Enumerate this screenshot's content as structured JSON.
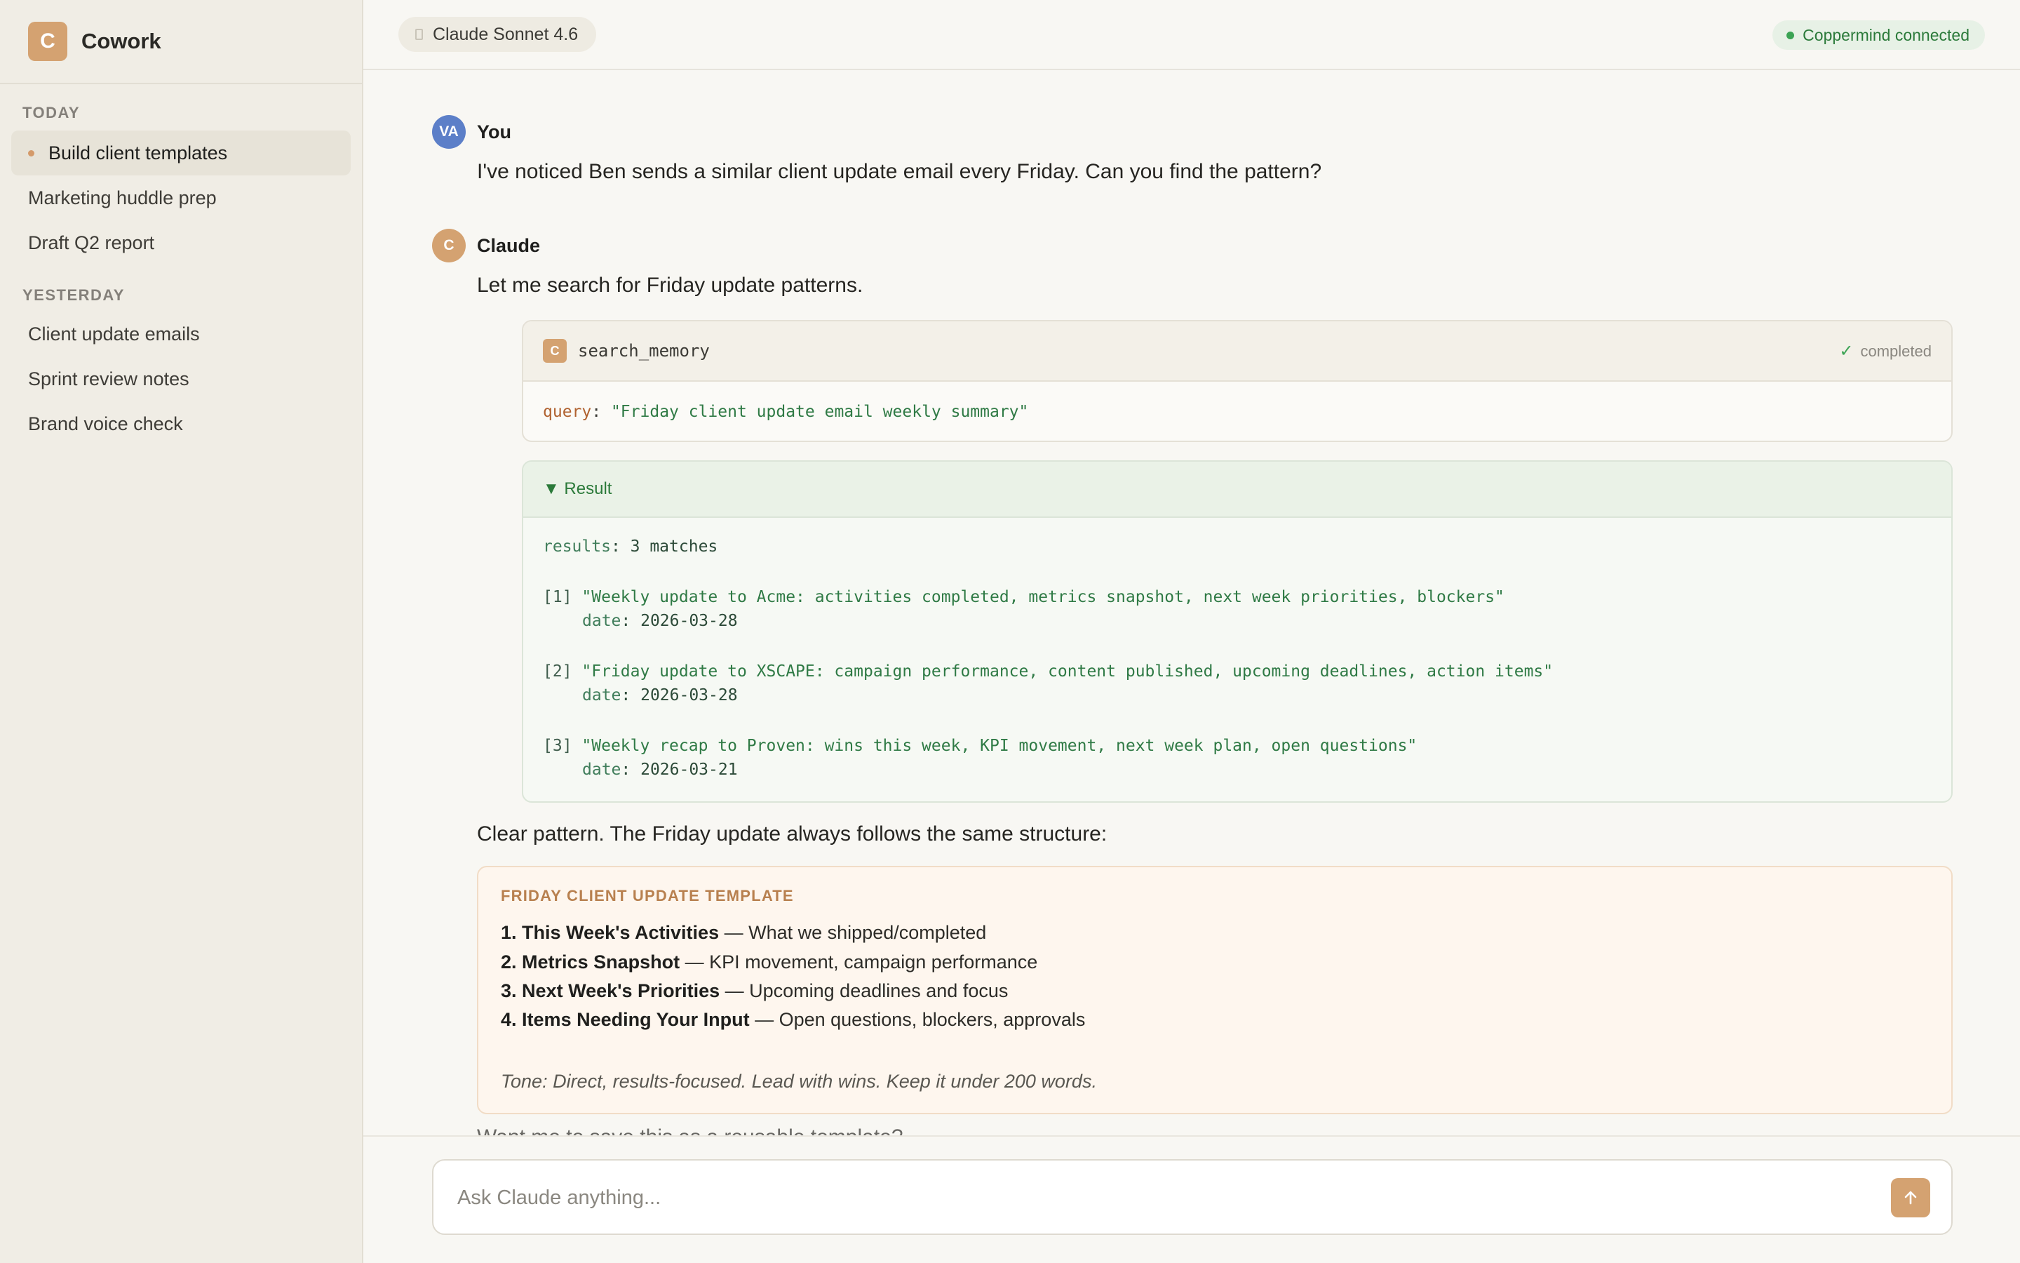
{
  "sidebar": {
    "brand_logo": "C",
    "brand_name": "Cowork",
    "sections": [
      {
        "label": "TODAY",
        "items": [
          "Build client templates",
          "Marketing huddle prep",
          "Draft Q2 report"
        ]
      },
      {
        "label": "YESTERDAY",
        "items": [
          "Client update emails",
          "Sprint review notes",
          "Brand voice check"
        ]
      }
    ],
    "active_item": "Build client templates"
  },
  "header": {
    "model": "Claude Sonnet 4.6",
    "connection_status": "Coppermind connected"
  },
  "conversation": {
    "user": {
      "avatar": "VA",
      "name": "You",
      "text": "I've noticed Ben sends a similar client update email every Friday. Can you find the pattern?"
    },
    "assistant": {
      "avatar": "C",
      "name": "Claude",
      "intro": "Let me search for Friday update patterns.",
      "tool": {
        "icon": "C",
        "name": "search_memory",
        "status": "completed",
        "param_key": "query",
        "param_value": "\"Friday client update email weekly summary\""
      },
      "result": {
        "header": "▼ Result",
        "results_key": "results",
        "results_value": "3 matches",
        "matches": [
          {
            "index": "[1]",
            "text": "\"Weekly update to Acme: activities completed, metrics snapshot, next week priorities, blockers\"",
            "date_key": "date",
            "date": "2026-03-28"
          },
          {
            "index": "[2]",
            "text": "\"Friday update to XSCAPE: campaign performance, content published, upcoming deadlines, action items\"",
            "date_key": "date",
            "date": "2026-03-28"
          },
          {
            "index": "[3]",
            "text": "\"Weekly recap to Proven: wins this week, KPI movement, next week plan, open questions\"",
            "date_key": "date",
            "date": "2026-03-21"
          }
        ]
      },
      "summary": "Clear pattern. The Friday update always follows the same structure:",
      "template": {
        "title": "FRIDAY CLIENT UPDATE TEMPLATE",
        "items": [
          {
            "num": "1.",
            "title": "This Week's Activities",
            "desc": "— What we shipped/completed"
          },
          {
            "num": "2.",
            "title": "Metrics Snapshot",
            "desc": "— KPI movement, campaign performance"
          },
          {
            "num": "3.",
            "title": "Next Week's Priorities",
            "desc": "— Upcoming deadlines and focus"
          },
          {
            "num": "4.",
            "title": "Items Needing Your Input",
            "desc": "— Open questions, blockers, approvals"
          }
        ],
        "tone": "Tone: Direct, results-focused. Lead with wins. Keep it under 200 words."
      },
      "truncated_followup": "Want me to save this as a reusable template?"
    }
  },
  "composer": {
    "placeholder": "Ask Claude anything..."
  },
  "colors": {
    "accent": "#d4a271",
    "user_avatar": "#5c7fc8",
    "connected_green": "#3ba354",
    "sidebar_bg": "#f0ede5",
    "main_bg": "#f8f7f3"
  },
  "icons": {
    "send": "arrow-up-icon",
    "status": "check-icon",
    "connection": "status-dot-icon",
    "model": "model-icon"
  }
}
